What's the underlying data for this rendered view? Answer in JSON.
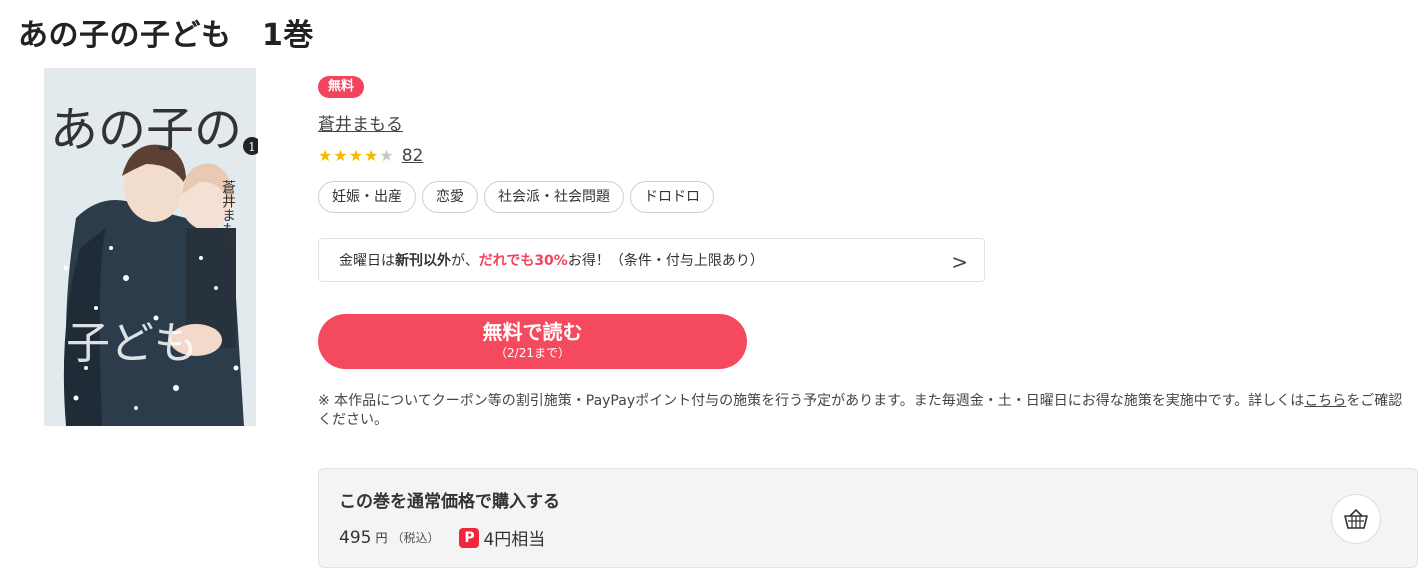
{
  "page_title": "あの子の子ども　1巻",
  "cover": {
    "title_art": "あの子の",
    "title_art2": "子ども",
    "volume": "1",
    "author_vertical": "蒼井まもる",
    "colors": {
      "bg": "#dfe8ec",
      "coat": "#2d3b48",
      "snow": "#ffffff"
    }
  },
  "badge": "無料",
  "author": "蒼井まもる",
  "rating": {
    "value": 4,
    "max": 5,
    "count": "82"
  },
  "tags": [
    "妊娠・出産",
    "恋愛",
    "社会派・社会問題",
    "ドロドロ"
  ],
  "promo": {
    "prefix": "金曜日は",
    "bold": "新刊以外",
    "mid": "が、",
    "highlight": "だれでも30%",
    "suffix": "お得！（条件・付与上限あり）",
    "chevron": ">"
  },
  "read_button": {
    "label": "無料で読む",
    "sub": "（2/21まで）"
  },
  "note": {
    "text": "※ 本作品についてクーポン等の割引施策・PayPayポイント付与の施策を行う予定があります。また毎週金・土・日曜日にお得な施策を実施中です。詳しくは",
    "link": "こちら",
    "tail": "をご確認ください。"
  },
  "purchase": {
    "title": "この巻を通常価格で購入する",
    "price": "495",
    "currency": "円",
    "tax": "（税込）",
    "paypay_icon": "P",
    "points": "4円相当",
    "cart_icon": "basket-icon"
  },
  "colors": {
    "accent": "#f54a5e",
    "star": "#f5b800",
    "paypay": "#f0263c"
  }
}
